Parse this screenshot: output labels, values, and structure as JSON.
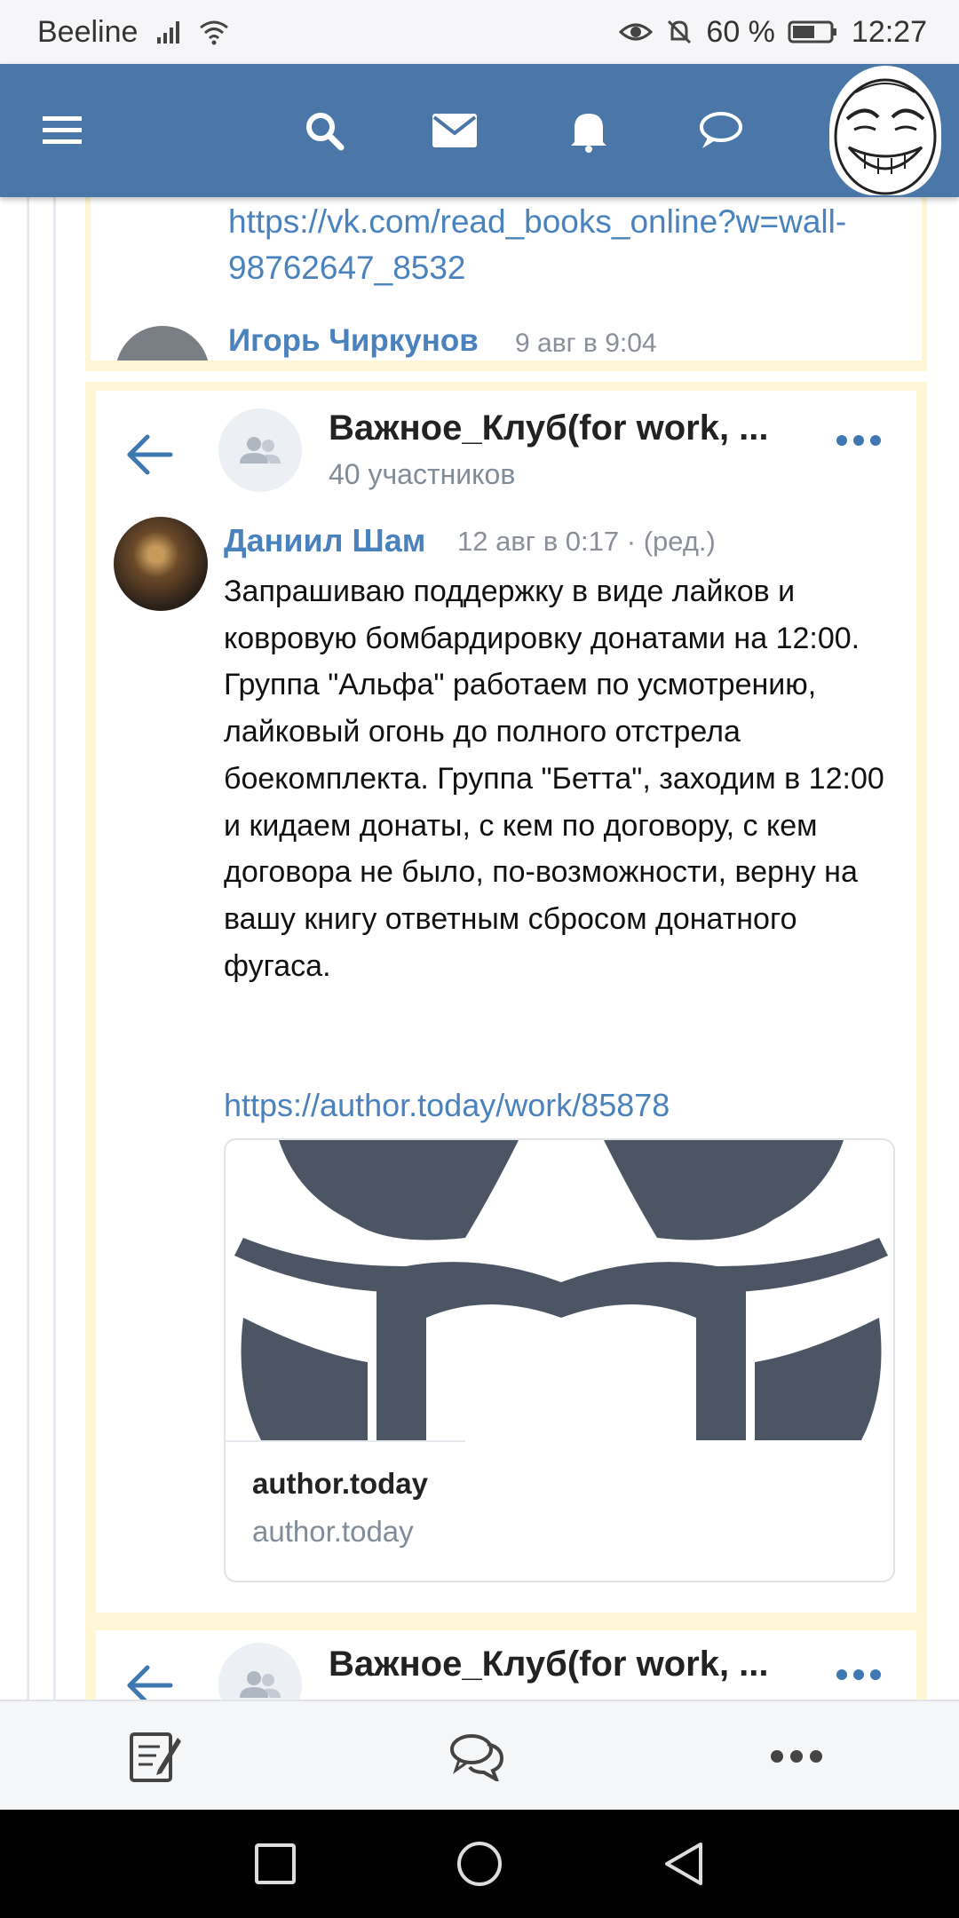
{
  "status_bar": {
    "carrier": "Beeline",
    "battery": "60 %",
    "time": "12:27"
  },
  "header": {
    "icons": [
      "menu-icon",
      "search-icon",
      "messages-icon",
      "notifications-icon",
      "chat-icon",
      "profile-avatar"
    ]
  },
  "prev_post": {
    "link": "https://vk.com/read_books_online?w=wall-98762647_8532",
    "author": "Игорь Чиркунов",
    "time": "9 авг в 9:04"
  },
  "post": {
    "group_title": "Важное_Клуб(for work, ...",
    "members": "40 участников",
    "author": "Даниил Шам",
    "time": "12 авг в 0:17 · (ред.)",
    "text": "Запрашиваю поддержку в виде лайков и ковровую бомбардировку донатами на 12:00. Группа \"Альфа\" работаем по усмотрению, лайковый огонь до полного отстрела боекомплекта. Группа \"Бетта\", заходим в 12:00 и кидаем донаты, с кем по договору, с кем договора не было, по-возможности, верну на вашу книгу ответным сбросом донатного фугаса.",
    "link": "https://author.today/work/85878",
    "snippet": {
      "title": "author.today",
      "domain": "author.today"
    }
  },
  "next_post": {
    "group_title": "Важное_Клуб(for work, ..."
  },
  "colors": {
    "header": "#4a76a8",
    "link": "#4a82bd",
    "highlight": "#fff6d6"
  }
}
